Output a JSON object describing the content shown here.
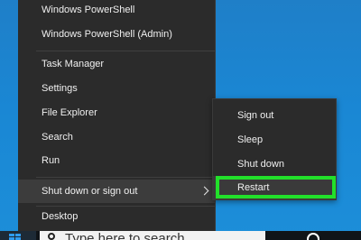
{
  "winx_menu": {
    "items": [
      {
        "label": "Windows PowerShell"
      },
      {
        "label": "Windows PowerShell (Admin)"
      },
      {
        "label": "Task Manager"
      },
      {
        "label": "Settings"
      },
      {
        "label": "File Explorer"
      },
      {
        "label": "Search"
      },
      {
        "label": "Run"
      },
      {
        "label": "Shut down or sign out"
      },
      {
        "label": "Desktop"
      }
    ]
  },
  "submenu": {
    "items": [
      {
        "label": "Sign out"
      },
      {
        "label": "Sleep"
      },
      {
        "label": "Shut down"
      },
      {
        "label": "Restart"
      }
    ]
  },
  "taskbar": {
    "search_text": "Type here to search"
  },
  "colors": {
    "desktop": "#1a87d4",
    "menu_background": "#2b2b2b",
    "highlight": "#22e02a"
  },
  "icons": {
    "start": "windows-logo-icon",
    "search": "search-icon",
    "tray": "network-icon",
    "submenu_arrow": "chevron-right-icon"
  }
}
